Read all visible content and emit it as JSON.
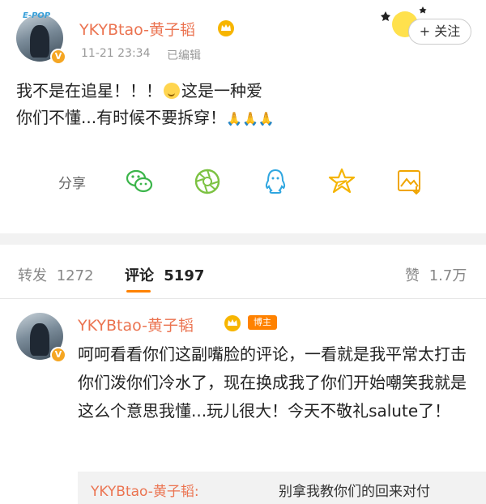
{
  "post": {
    "username": "YKYBtao-黄子韬",
    "timestamp": "11-21 23:34",
    "edited": "已编辑",
    "follow_label": "+ 关注",
    "sticker_text": "E-POP",
    "line1a": "我不是在追星！！！",
    "line1b": "这是一种爱",
    "line2": "你们不懂...有时候不要拆穿！",
    "pray_emoji": "🙏🙏🙏",
    "share_label": "分享"
  },
  "share_icons": [
    "wechat-icon",
    "moments-icon",
    "qq-icon",
    "qzone-icon",
    "save-image-icon"
  ],
  "tabs": {
    "repost_label": "转发",
    "repost_count": "1272",
    "comment_label": "评论",
    "comment_count": "5197",
    "like_label": "赞",
    "like_count": "1.7万"
  },
  "comment": {
    "username": "YKYBtao-黄子韬",
    "badge": "博主",
    "text": "呵呵看看你们这副嘴脸的评论，一看就是我平常太打击你们泼你们冷水了，现在换成我了你们开始嘲笑我就是这么个意思我懂...玩儿很大！今天不敬礼salute了！",
    "reply_name": "YKYBtao-黄子韬:",
    "reply_text": "别拿我教你们的回来对付"
  },
  "colors": {
    "accent": "#ff8200",
    "username": "#eb7350",
    "verified": "#f5a623"
  }
}
